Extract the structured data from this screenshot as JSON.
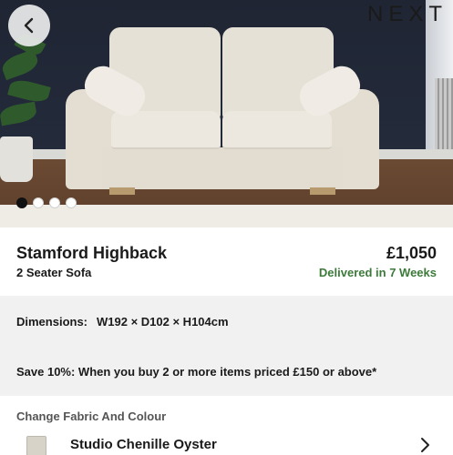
{
  "header": {
    "brand": "NEXT",
    "back_icon": "chevron-left-icon"
  },
  "gallery": {
    "image_count": 4,
    "active_index": 0
  },
  "product": {
    "name": "Stamford Highback",
    "subtitle": "2 Seater Sofa",
    "price": "£1,050",
    "delivery": "Delivered in 7 Weeks"
  },
  "details": {
    "dimensions_label": "Dimensions:",
    "dimensions_value": "W192 × D102 × H104cm",
    "offer": "Save 10%: When you buy 2 or more items priced £150 or above*"
  },
  "fabric": {
    "section_label": "Change Fabric And Colour",
    "selected_name": "Studio Chenille Oyster",
    "chevron_icon": "chevron-right-icon"
  },
  "colors": {
    "delivery_green": "#3c7a3a",
    "info_panel_bg": "#f1f1f1"
  }
}
